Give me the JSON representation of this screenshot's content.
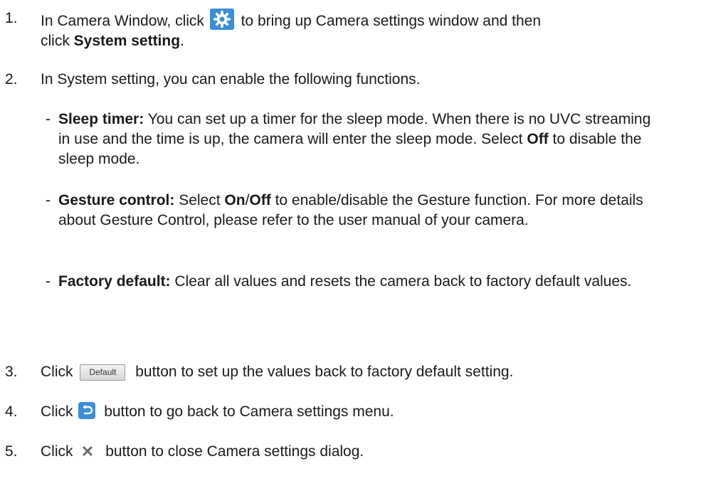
{
  "steps": [
    {
      "num": "1.",
      "pre": "In Camera Window, click",
      "post": "to bring up Camera settings window and then",
      "line2_pre": "click ",
      "line2_bold": "System setting",
      "line2_post": ".",
      "icon": "gear-icon"
    },
    {
      "num": "2.",
      "text": "In System setting, you can enable the following functions."
    },
    {
      "num": "3.",
      "pre": "Click",
      "button_label": "Default",
      "post": "button to set up the values back to factory default setting."
    },
    {
      "num": "4.",
      "pre": "Click",
      "post": "button to go back to Camera settings menu.",
      "icon": "back-icon"
    },
    {
      "num": "5.",
      "pre": "Click",
      "post": "button to close Camera settings dialog.",
      "icon": "close-icon"
    }
  ],
  "bullets": {
    "sleep": {
      "dash": "-",
      "title": "Sleep timer:",
      "text": "You can set up a timer for the sleep mode. When there is no UVC streaming in use and the time is up, the camera will enter the sleep mode. Select ",
      "bold_end": "Off",
      "post": " to disable the sleep mode."
    },
    "gesture": {
      "dash": "-",
      "title": "Gesture control:",
      "text_pre": "Select ",
      "on": "On",
      "slash": "/",
      "off": "Off",
      "text_post": " to enable/disable the Gesture function. For more details about Gesture Control, please refer to the user manual of your camera."
    },
    "factory": {
      "dash": "-",
      "title": "Factory default:",
      "text": "Clear all values and resets the camera back to factory default values."
    }
  },
  "colors": {
    "text": "#1a1a1a",
    "gear_bg": "#3a8fd6",
    "back_bg": "#3a8fd6"
  }
}
